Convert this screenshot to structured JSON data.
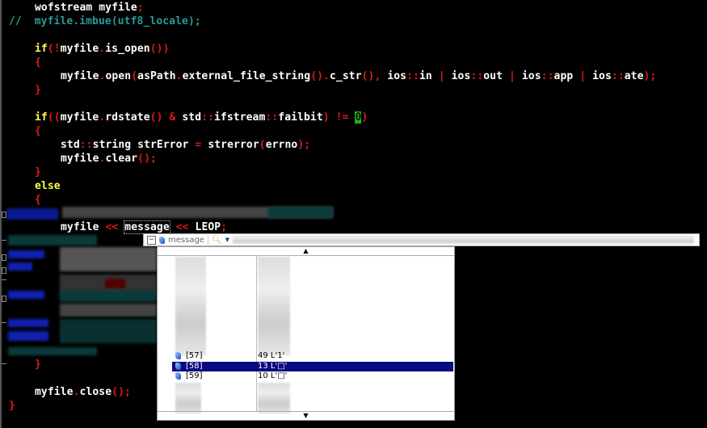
{
  "code_lines": [
    {
      "segs": [
        [
          "wofstream myfile",
          "w"
        ],
        [
          ";",
          "p"
        ]
      ],
      "indent": 4
    },
    {
      "segs": [
        [
          "//  ",
          "c"
        ],
        [
          "myfile.imbue(utf8_locale);",
          "c"
        ]
      ],
      "indent": 0
    },
    {
      "segs": [],
      "indent": 0
    },
    {
      "segs": [
        [
          "if",
          "k"
        ],
        [
          "(!",
          "p"
        ],
        [
          "myfile",
          "w"
        ],
        [
          ".",
          "p"
        ],
        [
          "is_open",
          "w"
        ],
        [
          "())",
          "p"
        ]
      ],
      "indent": 4
    },
    {
      "segs": [
        [
          "{",
          "p"
        ]
      ],
      "indent": 4
    },
    {
      "segs": [
        [
          "myfile",
          "w"
        ],
        [
          ".",
          "p"
        ],
        [
          "open",
          "w"
        ],
        [
          "(",
          "p"
        ],
        [
          "asPath",
          "w"
        ],
        [
          ".",
          "p"
        ],
        [
          "external_file_string",
          "w"
        ],
        [
          "().",
          "p"
        ],
        [
          "c_str",
          "w"
        ],
        [
          "(),",
          "p"
        ],
        [
          " ios",
          "w"
        ],
        [
          "::",
          "p"
        ],
        [
          "in ",
          "w"
        ],
        [
          "|",
          "p"
        ],
        [
          " ios",
          "w"
        ],
        [
          "::",
          "p"
        ],
        [
          "out ",
          "w"
        ],
        [
          "|",
          "p"
        ],
        [
          " ios",
          "w"
        ],
        [
          "::",
          "p"
        ],
        [
          "app ",
          "w"
        ],
        [
          "|",
          "p"
        ],
        [
          " ios",
          "w"
        ],
        [
          "::",
          "p"
        ],
        [
          "ate",
          "w"
        ],
        [
          ");",
          "p"
        ]
      ],
      "indent": 8
    },
    {
      "segs": [
        [
          "}",
          "p"
        ]
      ],
      "indent": 4
    },
    {
      "segs": [],
      "indent": 0
    },
    {
      "segs": [
        [
          "if",
          "k"
        ],
        [
          "((",
          "p"
        ],
        [
          "myfile",
          "w"
        ],
        [
          ".",
          "p"
        ],
        [
          "rdstate",
          "w"
        ],
        [
          "()",
          "p"
        ],
        [
          " & ",
          "p"
        ],
        [
          "std",
          "w"
        ],
        [
          "::",
          "p"
        ],
        [
          "ifstream",
          "w"
        ],
        [
          "::",
          "p"
        ],
        [
          "failbit",
          "w"
        ],
        [
          ")",
          "p"
        ],
        [
          " != ",
          "p"
        ],
        [
          "0",
          "n"
        ],
        [
          ")",
          "p"
        ]
      ],
      "indent": 4
    },
    {
      "segs": [
        [
          "{",
          "p"
        ]
      ],
      "indent": 4
    },
    {
      "segs": [
        [
          "std",
          "w"
        ],
        [
          "::",
          "p"
        ],
        [
          "string strError ",
          "w"
        ],
        [
          "=",
          "p"
        ],
        [
          " strerror",
          "w"
        ],
        [
          "(",
          "p"
        ],
        [
          "errno",
          "w"
        ],
        [
          ");",
          "p"
        ]
      ],
      "indent": 8
    },
    {
      "segs": [
        [
          "myfile",
          "w"
        ],
        [
          ".",
          "p"
        ],
        [
          "clear",
          "w"
        ],
        [
          "();",
          "p"
        ]
      ],
      "indent": 8
    },
    {
      "segs": [
        [
          "}",
          "p"
        ]
      ],
      "indent": 4
    },
    {
      "segs": [
        [
          "else",
          "k"
        ]
      ],
      "indent": 4
    },
    {
      "segs": [
        [
          "{",
          "p"
        ]
      ],
      "indent": 4
    },
    {
      "segs": [],
      "indent": 0
    },
    {
      "segs": [
        [
          "myfile ",
          "w"
        ],
        [
          "<<",
          "p"
        ],
        [
          " ",
          "w"
        ],
        [
          "message",
          "w"
        ],
        [
          " ",
          "w"
        ],
        [
          "<<",
          "p"
        ],
        [
          " LEOP",
          "w"
        ],
        [
          ";",
          "p"
        ]
      ],
      "indent": 8
    }
  ],
  "tail_lines": [
    {
      "segs": [
        [
          "}",
          "p"
        ]
      ],
      "indent": 4,
      "row": 26
    },
    {
      "segs": [
        [
          "myfile",
          "w"
        ],
        [
          ".",
          "p"
        ],
        [
          "close",
          "w"
        ],
        [
          "();",
          "p"
        ]
      ],
      "indent": 4,
      "row": 28
    },
    {
      "segs": [
        [
          "}",
          "p"
        ]
      ],
      "indent": 0,
      "row": 29
    }
  ],
  "tooltip": {
    "variable": "message",
    "search_icon": "magnifier-icon"
  },
  "watch_rows": [
    {
      "index": "[57]",
      "value": "49 L'1'",
      "selected": false
    },
    {
      "index": "[58]",
      "value": "13 L'□'",
      "selected": true
    },
    {
      "index": "[59]",
      "value": "10 L'□'",
      "selected": false
    }
  ],
  "scroll_up": "▲",
  "scroll_down": "▼"
}
